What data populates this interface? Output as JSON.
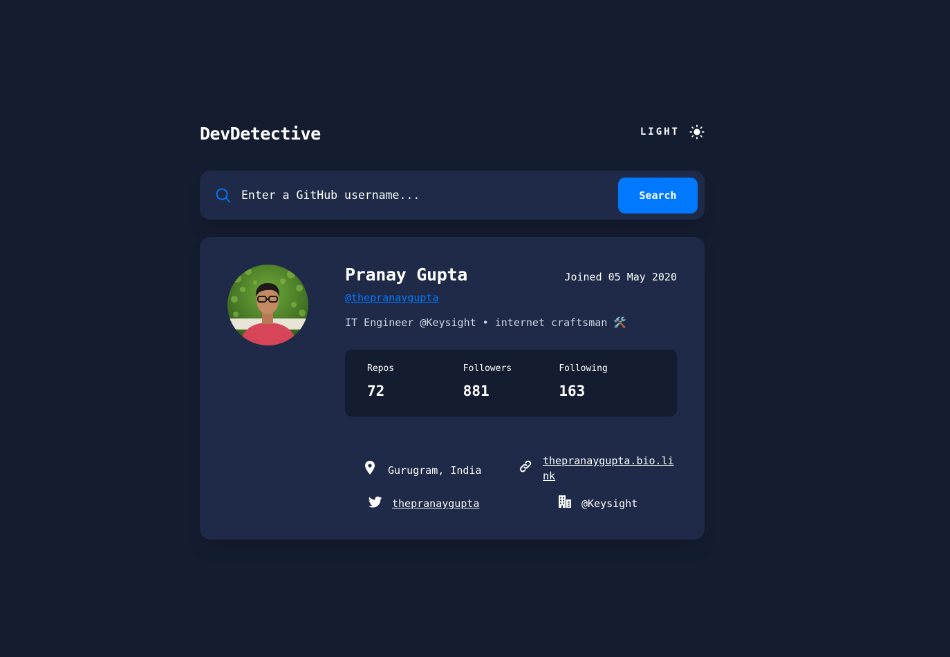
{
  "header": {
    "logo": "DevDetective",
    "theme_label": "LIGHT",
    "theme_icon": "sun-icon"
  },
  "search": {
    "placeholder": "Enter a GitHub username...",
    "value": "",
    "button_label": "Search",
    "icon": "search-icon"
  },
  "profile": {
    "name": "Pranay Gupta",
    "joined": "Joined 05 May 2020",
    "handle": "@thepranaygupta",
    "bio": "IT Engineer @Keysight • internet craftsman 🛠️",
    "avatar": "avatar-photo"
  },
  "stats": [
    {
      "label": "Repos",
      "value": "72"
    },
    {
      "label": "Followers",
      "value": "881"
    },
    {
      "label": "Following",
      "value": "163"
    }
  ],
  "links": {
    "location": {
      "icon": "location-pin-icon",
      "text": "Gurugram, India"
    },
    "website": {
      "icon": "link-icon",
      "text": "thepranaygupta.bio.link"
    },
    "twitter": {
      "icon": "twitter-icon",
      "text": "thepranaygupta"
    },
    "company": {
      "icon": "building-icon",
      "text": "@Keysight"
    }
  },
  "colors": {
    "background": "#141c2f",
    "card": "#1e2a47",
    "accent": "#0079ff",
    "text": "#ffffff"
  }
}
